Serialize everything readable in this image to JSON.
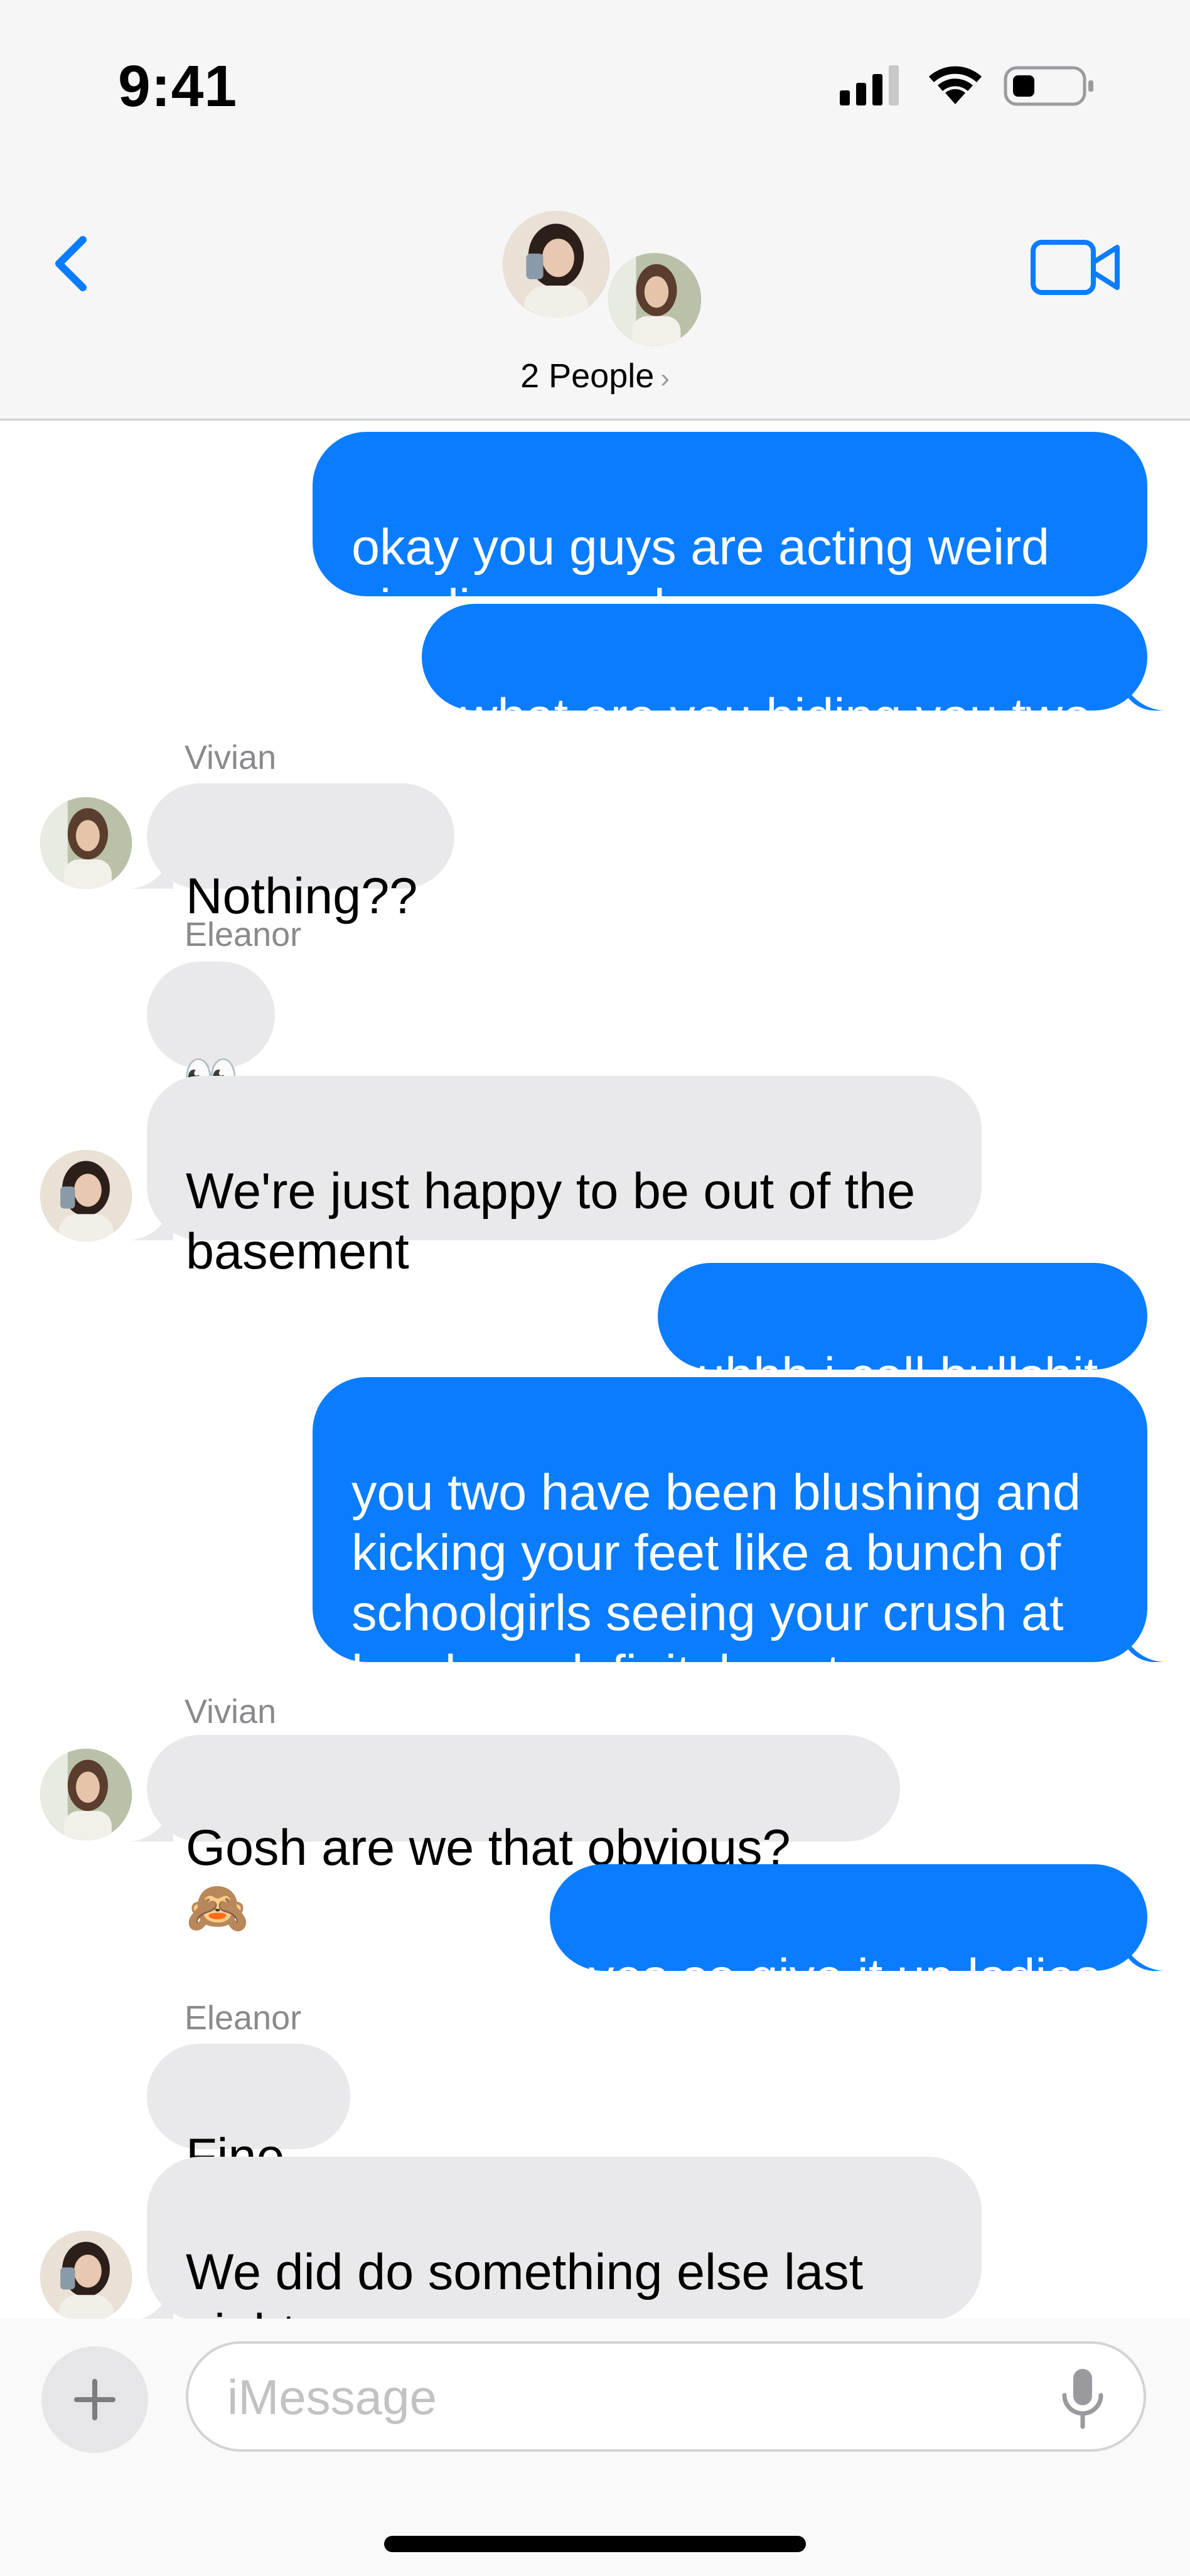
{
  "status_bar": {
    "time": "9:41"
  },
  "header": {
    "title": "2 People",
    "chevron": "›"
  },
  "messages": [
    {
      "from": "me",
      "text": "okay you guys are acting weird\ngiggling over bacon"
    },
    {
      "from": "me",
      "text": "what are you hiding you two"
    },
    {
      "from": "Vivian",
      "sender_label": "Vivian",
      "text": "Nothing??"
    },
    {
      "from": "Eleanor",
      "sender_label": "Eleanor",
      "text": "👀"
    },
    {
      "from": "Eleanor",
      "text": "We're just happy to be out of the\nbasement"
    },
    {
      "from": "me",
      "text": "uhhh i call bullshit"
    },
    {
      "from": "me",
      "text": "you two have been blushing and\nkicking your feet like a bunch of\nschoolgirls seeing your crush at\nlunch so definitely not"
    },
    {
      "from": "Vivian",
      "sender_label": "Vivian",
      "text": "Gosh are we that obvious? 🙈"
    },
    {
      "from": "me",
      "text": "yes so give it up ladies"
    },
    {
      "from": "Eleanor",
      "sender_label": "Eleanor",
      "text": "Fine.."
    },
    {
      "from": "Eleanor",
      "text": "We did do something else last\nnight.."
    }
  ],
  "composer": {
    "placeholder": "iMessage"
  },
  "colors": {
    "outgoing": "#0a7cff",
    "incoming": "#e9e9eb",
    "accent": "#0a7cff"
  },
  "icons": [
    "back-chevron-icon",
    "video-camera-icon",
    "plus-icon",
    "microphone-icon",
    "signal-icon",
    "wifi-icon",
    "battery-icon"
  ]
}
